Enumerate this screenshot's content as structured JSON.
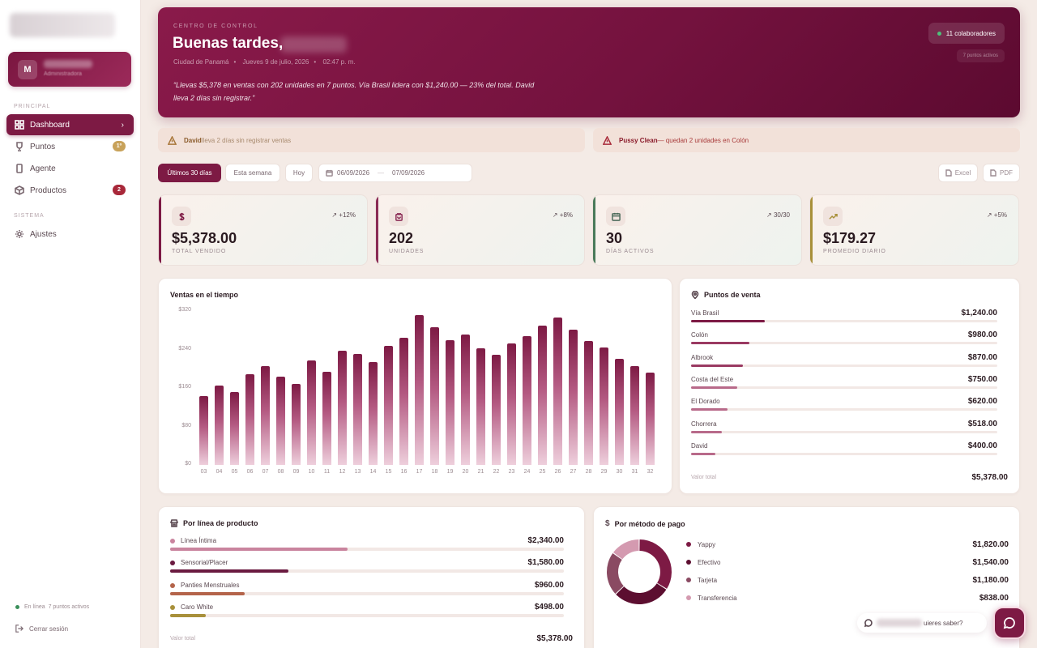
{
  "sidebar": {
    "user_initial": "M",
    "user_role": "Administradora",
    "section_principal": "PRINCIPAL",
    "section_sistema": "SISTEMA",
    "items": [
      {
        "label": "Dashboard",
        "icon": "grid-icon",
        "active": true
      },
      {
        "label": "Puntos",
        "icon": "trophy-icon",
        "badge": "1º"
      },
      {
        "label": "Agente",
        "icon": "phone-icon"
      },
      {
        "label": "Productos",
        "icon": "box-icon",
        "badge": "2"
      },
      {
        "label": "Ajustes",
        "icon": "gear-icon"
      }
    ],
    "online_label": "En línea",
    "online_points": "7 puntos activos",
    "logout_label": "Cerrar sesión"
  },
  "hero": {
    "eyebrow": "CENTRO DE CONTROL",
    "greeting": "Buenas tardes,",
    "city": "Ciudad de Panamá",
    "date": "Jueves 9 de julio, 2026",
    "time": "02:47 p. m.",
    "quote": "“Llevas $5,378 en ventas con 202 unidades en 7 puntos. Vía Brasil lidera con $1,240.00 — 23% del total. David lleva 2 días sin registrar.”",
    "collaborators": "11 colaboradores",
    "active_points": "7 puntos activos"
  },
  "alerts": [
    {
      "strong": "David",
      "text": " lleva 2 días sin registrar ventas"
    },
    {
      "strong": "Pussy Clean",
      "text": " — quedan 2 unidades en Colón"
    }
  ],
  "filters": {
    "last30": "Últimos 30 días",
    "week": "Esta semana",
    "today": "Hoy",
    "date_from": "06/09/2026",
    "date_to": "07/09/2026",
    "excel": "Excel",
    "pdf": "PDF"
  },
  "kpis": [
    {
      "value": "$5,378.00",
      "label": "TOTAL VENDIDO",
      "delta": "+12%",
      "color": "#7d1a44",
      "icon": "dollar-icon"
    },
    {
      "value": "202",
      "label": "UNIDADES",
      "delta": "+8%",
      "color": "#8a2a54",
      "icon": "bag-icon"
    },
    {
      "value": "30",
      "label": "DÍAS ACTIVOS",
      "delta": "30/30",
      "color": "#4a7a5a",
      "icon": "calendar-icon"
    },
    {
      "value": "$179.27",
      "label": "PROMEDIO DIARIO",
      "delta": "+5%",
      "color": "#a8903a",
      "icon": "trend-icon"
    }
  ],
  "sales_chart": {
    "title": "Ventas en el tiempo"
  },
  "chart_data": {
    "type": "bar",
    "title": "Ventas en el tiempo",
    "categories": [
      "03",
      "04",
      "05",
      "06",
      "07",
      "08",
      "09",
      "10",
      "11",
      "12",
      "13",
      "14",
      "15",
      "16",
      "17",
      "18",
      "19",
      "20",
      "21",
      "22",
      "23",
      "24",
      "25",
      "26",
      "27",
      "28",
      "29",
      "30",
      "31",
      "32"
    ],
    "values": [
      143,
      165,
      151,
      188,
      206,
      183,
      168,
      218,
      193,
      238,
      230,
      214,
      247,
      264,
      311,
      286,
      260,
      272,
      243,
      229,
      252,
      268,
      290,
      307,
      281,
      257,
      244,
      221,
      205,
      192
    ],
    "y_ticks": [
      "$320",
      "$240",
      "$160",
      "$80",
      "$0"
    ],
    "ylim": [
      0,
      320
    ]
  },
  "points": {
    "title": "Puntos de venta",
    "rows": [
      {
        "name": "Vía Brasil",
        "value": "$1,240.00",
        "share": 0.24
      },
      {
        "name": "Colón",
        "value": "$980.00",
        "share": 0.19
      },
      {
        "name": "Albrook",
        "value": "$870.00",
        "share": 0.17
      },
      {
        "name": "Costa del Este",
        "value": "$750.00",
        "share": 0.15
      },
      {
        "name": "El Dorado",
        "value": "$620.00",
        "share": 0.12
      },
      {
        "name": "Chorrera",
        "value": "$518.00",
        "share": 0.1
      },
      {
        "name": "David",
        "value": "$400.00",
        "share": 0.08
      }
    ],
    "total_label": "Valor total",
    "total_value": "$5,378.00"
  },
  "lines": {
    "title": "Por línea de producto",
    "rows": [
      {
        "name": "Línea Íntima",
        "value": "$2,340.00",
        "color": "#c9849e",
        "share": 0.45
      },
      {
        "name": "Sensorial/Placer",
        "value": "$1,580.00",
        "color": "#6a1a40",
        "share": 0.3
      },
      {
        "name": "Panties Menstruales",
        "value": "$960.00",
        "color": "#b4644a",
        "share": 0.19
      },
      {
        "name": "Caro White",
        "value": "$498.00",
        "color": "#a8903a",
        "share": 0.09
      }
    ],
    "total_label": "Valor total",
    "total_value": "$5,378.00"
  },
  "payments": {
    "title": "Por método de pago",
    "rows": [
      {
        "name": "Yappy",
        "value": "$1,820.00",
        "color": "#7d1a44",
        "share": 0.34
      },
      {
        "name": "Efectivo",
        "value": "$1,540.00",
        "color": "#5c0e30",
        "share": 0.29
      },
      {
        "name": "Tarjeta",
        "value": "$1,180.00",
        "color": "#8a4a62",
        "share": 0.22
      },
      {
        "name": "Transferencia",
        "value": "$838.00",
        "color": "#d49ab0",
        "share": 0.15
      }
    ]
  },
  "assistant": {
    "prompt_tail": "uieres saber?"
  }
}
